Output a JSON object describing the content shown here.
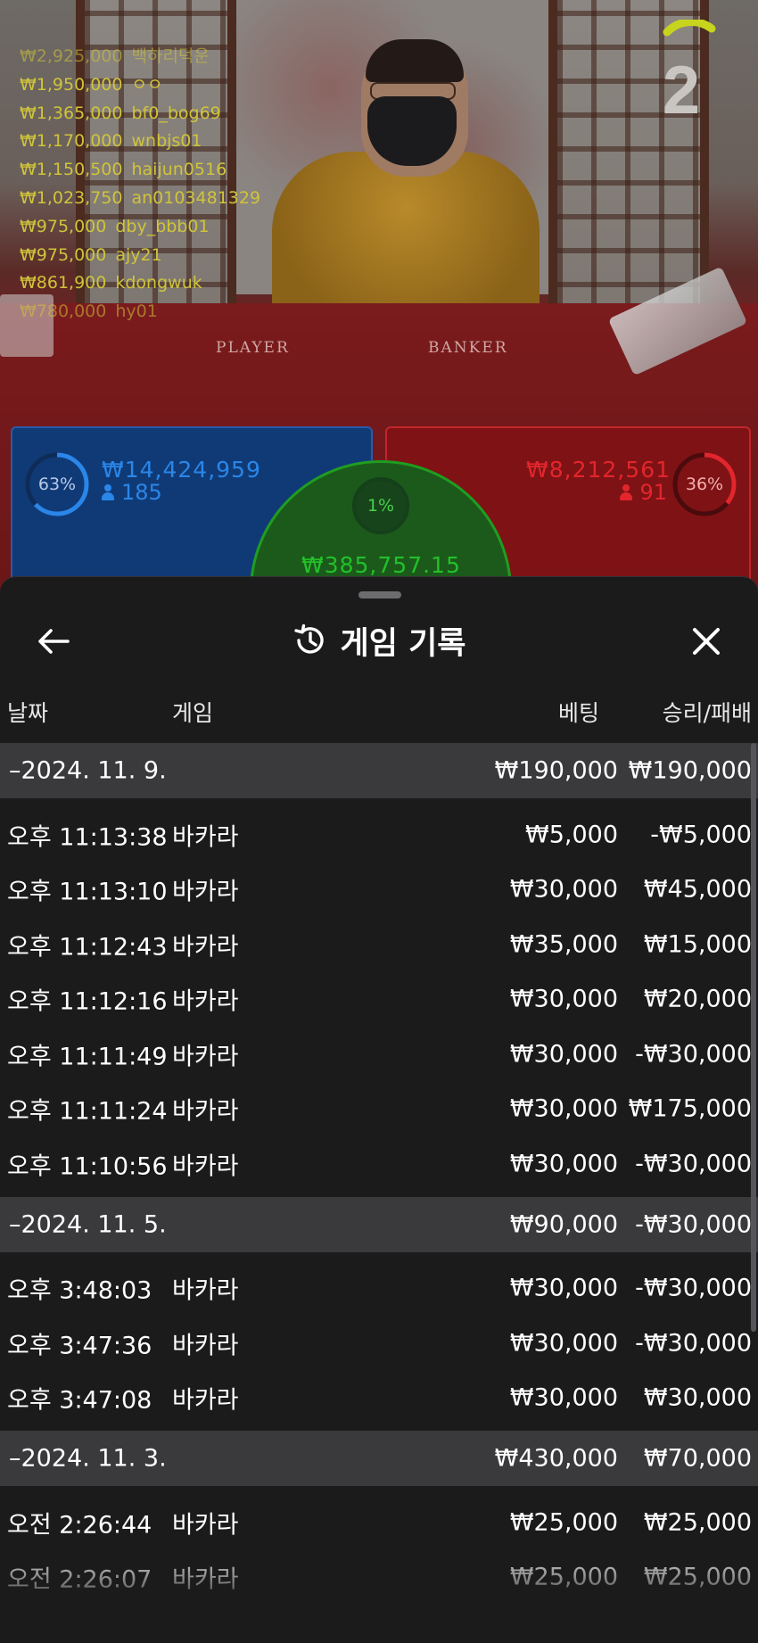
{
  "video": {
    "timer": "2",
    "table_labels": {
      "player": "PLAYER",
      "banker": "BANKER"
    },
    "leaderboard": [
      {
        "amount": "₩2,925,000",
        "name": "백하리덕운"
      },
      {
        "amount": "₩1,950,000",
        "name": "ㅇㅇ"
      },
      {
        "amount": "₩1,365,000",
        "name": "bf0_bog69"
      },
      {
        "amount": "₩1,170,000",
        "name": "wnbjs01"
      },
      {
        "amount": "₩1,150,500",
        "name": "haijun0516"
      },
      {
        "amount": "₩1,023,750",
        "name": "an0103481329"
      },
      {
        "amount": "₩975,000",
        "name": "dby_bbb01"
      },
      {
        "amount": "₩975,000",
        "name": "ajy21"
      },
      {
        "amount": "₩861,900",
        "name": "kdongwuk"
      },
      {
        "amount": "₩780,000",
        "name": "hy01"
      }
    ],
    "player_bet": {
      "percent": "63%",
      "percent_value": 63,
      "amount": "₩14,424,959",
      "count": "185",
      "color": "#2a86e8"
    },
    "banker_bet": {
      "percent": "36%",
      "percent_value": 36,
      "amount": "₩8,212,561",
      "count": "91",
      "color": "#e1262c"
    },
    "tie_bet": {
      "percent": "1%",
      "percent_value": 1,
      "amount": "₩385,757.15",
      "color": "#22c02a"
    }
  },
  "sheet": {
    "title": "게임 기록",
    "icons": {
      "back": "arrow-left-icon",
      "history": "history-icon",
      "close": "close-icon"
    },
    "columns": {
      "date": "날짜",
      "game": "게임",
      "bet": "베팅",
      "profit": "승리/패배"
    },
    "groups": [
      {
        "date": "–2024. 11. 9.",
        "bet": "₩190,000",
        "profit": "₩190,000",
        "rows": [
          {
            "time": "오후 11:13:38",
            "game": "바카라",
            "bet": "₩5,000",
            "profit": "-₩5,000"
          },
          {
            "time": "오후 11:13:10",
            "game": "바카라",
            "bet": "₩30,000",
            "profit": "₩45,000"
          },
          {
            "time": "오후 11:12:43",
            "game": "바카라",
            "bet": "₩35,000",
            "profit": "₩15,000"
          },
          {
            "time": "오후 11:12:16",
            "game": "바카라",
            "bet": "₩30,000",
            "profit": "₩20,000"
          },
          {
            "time": "오후 11:11:49",
            "game": "바카라",
            "bet": "₩30,000",
            "profit": "-₩30,000"
          },
          {
            "time": "오후 11:11:24",
            "game": "바카라",
            "bet": "₩30,000",
            "profit": "₩175,000"
          },
          {
            "time": "오후 11:10:56",
            "game": "바카라",
            "bet": "₩30,000",
            "profit": "-₩30,000"
          }
        ]
      },
      {
        "date": "–2024. 11. 5.",
        "bet": "₩90,000",
        "profit": "-₩30,000",
        "rows": [
          {
            "time": "오후 3:48:03",
            "game": "바카라",
            "bet": "₩30,000",
            "profit": "-₩30,000"
          },
          {
            "time": "오후 3:47:36",
            "game": "바카라",
            "bet": "₩30,000",
            "profit": "-₩30,000"
          },
          {
            "time": "오후 3:47:08",
            "game": "바카라",
            "bet": "₩30,000",
            "profit": "₩30,000"
          }
        ]
      },
      {
        "date": "–2024. 11. 3.",
        "bet": "₩430,000",
        "profit": "₩70,000",
        "rows": [
          {
            "time": "오전 2:26:44",
            "game": "바카라",
            "bet": "₩25,000",
            "profit": "₩25,000"
          },
          {
            "time": "오전 2:26:07",
            "game": "바카라",
            "bet": "₩25,000",
            "profit": "₩25,000"
          }
        ]
      }
    ]
  }
}
